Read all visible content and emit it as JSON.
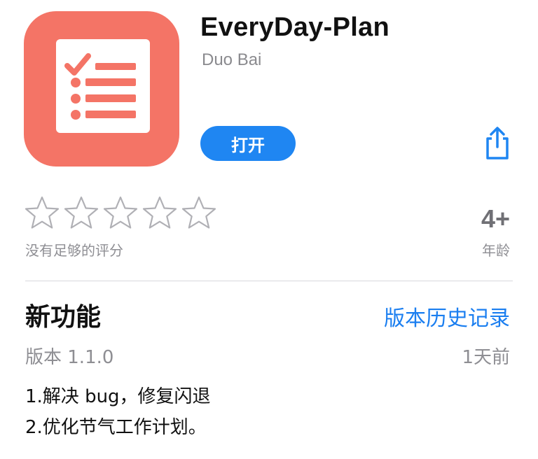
{
  "app": {
    "name": "EveryDay-Plan",
    "developer": "Duo Bai",
    "open_label": "打开",
    "icon": "checklist-icon",
    "icon_color": "#f47466"
  },
  "share": {
    "icon": "share-icon",
    "color": "#1f86f2"
  },
  "rating": {
    "stars_filled": 0,
    "stars_total": 5,
    "note": "没有足够的评分"
  },
  "age": {
    "value": "4+",
    "label": "年龄"
  },
  "whats_new": {
    "title": "新功能",
    "history_link": "版本历史记录",
    "version": "版本 1.1.0",
    "time": "1天前",
    "notes": [
      "1.解决 bug，修复闪退",
      "2.优化节气工作计划。"
    ]
  },
  "colors": {
    "accent": "#1f86f2",
    "secondary_text": "#8e8e93"
  }
}
